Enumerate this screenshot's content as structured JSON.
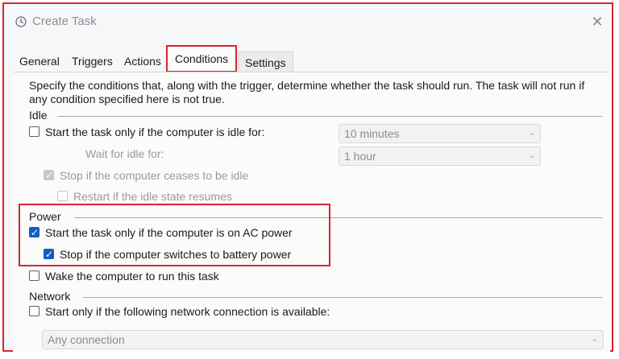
{
  "window": {
    "title": "Create Task",
    "icon": "clock-icon",
    "close_icon": "close-icon"
  },
  "tabs": [
    {
      "label": "General"
    },
    {
      "label": "Triggers"
    },
    {
      "label": "Actions"
    },
    {
      "label": "Conditions",
      "active": true
    },
    {
      "label": "Settings"
    }
  ],
  "intro": "Specify the conditions that, along with the trigger, determine whether the task should run.  The task will not run  if any condition specified here is not true.",
  "idle": {
    "heading": "Idle",
    "start_if_idle": {
      "label": "Start the task only if the computer is idle for:",
      "checked": false
    },
    "idle_duration": {
      "value": "10 minutes"
    },
    "wait_label": "Wait for idle for:",
    "wait_duration": {
      "value": "1 hour"
    },
    "stop_if_ceases": {
      "label": "Stop if the computer ceases to be idle",
      "checked": true,
      "enabled": false
    },
    "restart_if_resumes": {
      "label": "Restart if the idle state resumes",
      "checked": false,
      "enabled": false
    }
  },
  "power": {
    "heading": "Power",
    "start_on_ac": {
      "label": "Start the task only if the computer is on AC power",
      "checked": true
    },
    "stop_on_battery": {
      "label": "Stop if the computer switches to battery power",
      "checked": true
    },
    "wake_to_run": {
      "label": "Wake the computer to run this task",
      "checked": false
    }
  },
  "network": {
    "heading": "Network",
    "start_if_network": {
      "label": "Start only if the following network connection is available:",
      "checked": false
    },
    "connection": {
      "value": "Any connection"
    }
  },
  "colors": {
    "highlight": "#d9262f",
    "checkbox_checked": "#0f5fc4"
  }
}
